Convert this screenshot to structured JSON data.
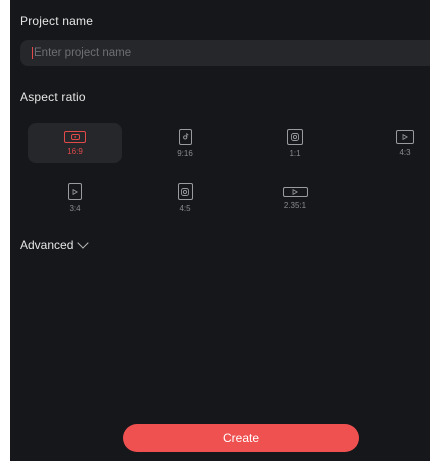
{
  "project_name": {
    "label": "Project name",
    "placeholder": "Enter project name"
  },
  "aspect_ratio": {
    "label": "Aspect ratio",
    "selected": "16:9",
    "accent_color": "#e24a4a",
    "options": [
      {
        "label": "16:9",
        "icon": "youtube-icon",
        "selected": true
      },
      {
        "label": "9:16",
        "icon": "tiktok-icon",
        "selected": false
      },
      {
        "label": "1:1",
        "icon": "instagram-icon",
        "selected": false
      },
      {
        "label": "4:3",
        "icon": "play-icon",
        "selected": false
      },
      {
        "label": "3:4",
        "icon": "play-icon",
        "selected": false
      },
      {
        "label": "4:5",
        "icon": "instagram-icon",
        "selected": false
      },
      {
        "label": "2.35:1",
        "icon": "play-icon",
        "selected": false
      }
    ]
  },
  "advanced": {
    "label": "Advanced",
    "icon": "chevron-down-icon"
  },
  "create_button": {
    "label": "Create",
    "color": "#ef5050"
  }
}
